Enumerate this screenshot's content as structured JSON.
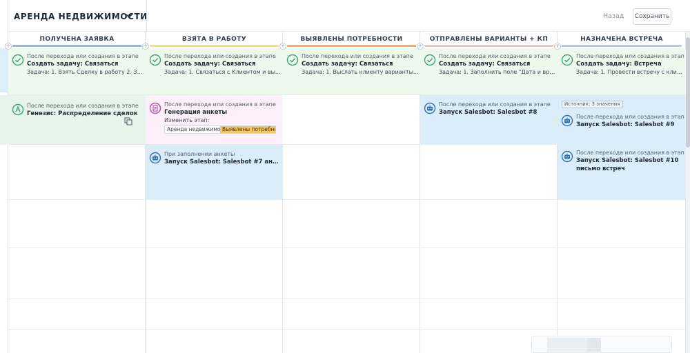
{
  "header": {
    "title": "АРЕНДА НЕДВИЖИМОСТИ",
    "back_label": "Назад",
    "save_label": "Сохранить"
  },
  "colors": {
    "stage_1": "#8fb8e6",
    "stage_2": "#f5e07a",
    "stage_3": "#f3b15e",
    "stage_4": "#f3c7c0",
    "stage_5": "#aecbef",
    "check_green": "#3aa373",
    "robot_blue": "#2f6fb3",
    "highlight_orange": "#f6c766"
  },
  "columns": [
    {
      "name": "ПОЛУЧЕНА ЗАЯВКА",
      "r1": {
        "condition": "После перехода или создания в этапе",
        "action": "Создать задачу: Связаться",
        "task": "Задача: 1. Взять Сделку в работу 2. Запо..."
      },
      "r2": {
        "condition": "После перехода или создания в этапе",
        "action": "Генезис: Распределение сделок"
      }
    },
    {
      "name": "ВЗЯТА В РАБОТУ",
      "r1": {
        "condition": "После перехода или создания в этапе",
        "action": "Создать задачу: Связаться",
        "task": "Задача: 1. Связаться с Клиентом и выяв..."
      },
      "r2": {
        "condition": "После перехода или создания в этапе",
        "action": "Генерация анкеты",
        "change_label": "Изменить этап:",
        "stage_from": "Аренда недвижимос",
        "stage_to": "Выявлены потребнос"
      },
      "r3": {
        "condition": "При заполнении анкеты",
        "action": "Запуск Salesbot: Salesbot #7 анкета 2"
      }
    },
    {
      "name": "ВЫЯВЛЕНЫ ПОТРЕБНОСТИ",
      "r1": {
        "condition": "После перехода или создания в этапе",
        "action": "Создать задачу: Связаться",
        "task": "Задача: 1. Выслать клиенту варианты кв..."
      }
    },
    {
      "name": "ОТПРАВЛЕНЫ ВАРИАНТЫ + КП",
      "r1": {
        "condition": "После перехода или создания в этапе",
        "action": "Создать задачу: Связаться",
        "task": "Задача: 1. Заполнить поле \"Дата и время..."
      },
      "r2": {
        "condition": "После перехода или создания в этапе",
        "action": "Запуск Salesbot: Salesbot #8"
      }
    },
    {
      "name": "НАЗНАЧЕНА ВСТРЕЧА",
      "r1": {
        "condition": "После перехода или создания в этапе",
        "action": "Создать задачу: Встреча",
        "task": "Задача: 1. Провести встречу с клиентом..."
      },
      "r2": {
        "source_badge": "Источник: 3 значения",
        "condition": "После перехода или создания в этапе",
        "action": "Запуск Salesbot: Salesbot #9"
      },
      "r3": {
        "condition": "После перехода или создания в этапе",
        "action": "Запуск Salesbot: Salesbot #10 письмо встреч"
      }
    }
  ]
}
